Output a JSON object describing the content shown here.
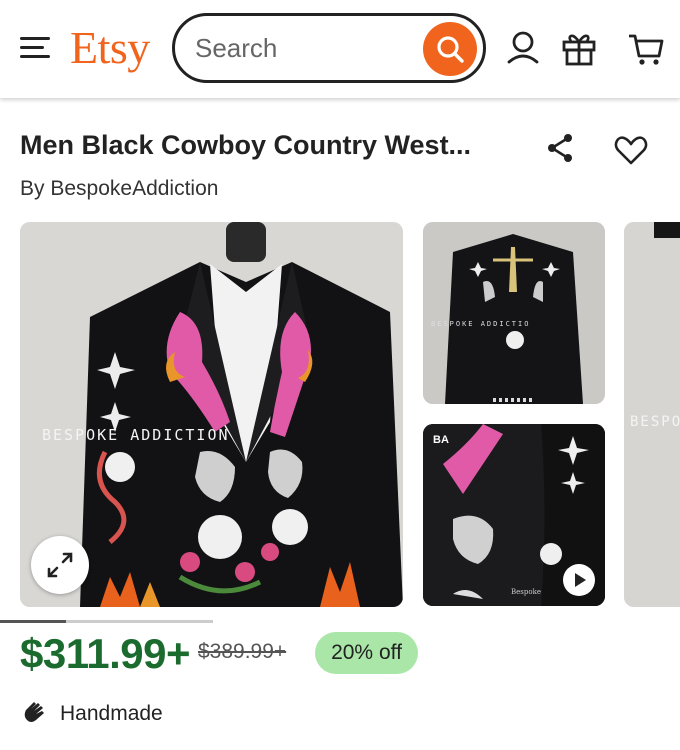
{
  "header": {
    "logo": "Etsy",
    "search_placeholder": "Search",
    "icons": [
      "menu-icon",
      "search-icon",
      "account-icon",
      "gift-icon",
      "cart-icon"
    ],
    "accent_color": "#f1641e"
  },
  "listing": {
    "title": "Men Black Cowboy Country West...",
    "byline": "By BespokeAddiction",
    "watermark_main": "BESPOKE ADDICTION",
    "watermark_thumb": "BESPOKE ADDICTIO",
    "watermark_side": "BESPO",
    "thumb_badge": "BA",
    "thumb_signature": "Bespoke",
    "gallery_progress": 0.31
  },
  "pricing": {
    "price": "$311.99+",
    "original_price": "$389.99+",
    "discount": "20% off",
    "price_color": "#1b6a2e",
    "badge_color": "#a9e6a7"
  },
  "attributes": {
    "handmade_label": "Handmade"
  }
}
